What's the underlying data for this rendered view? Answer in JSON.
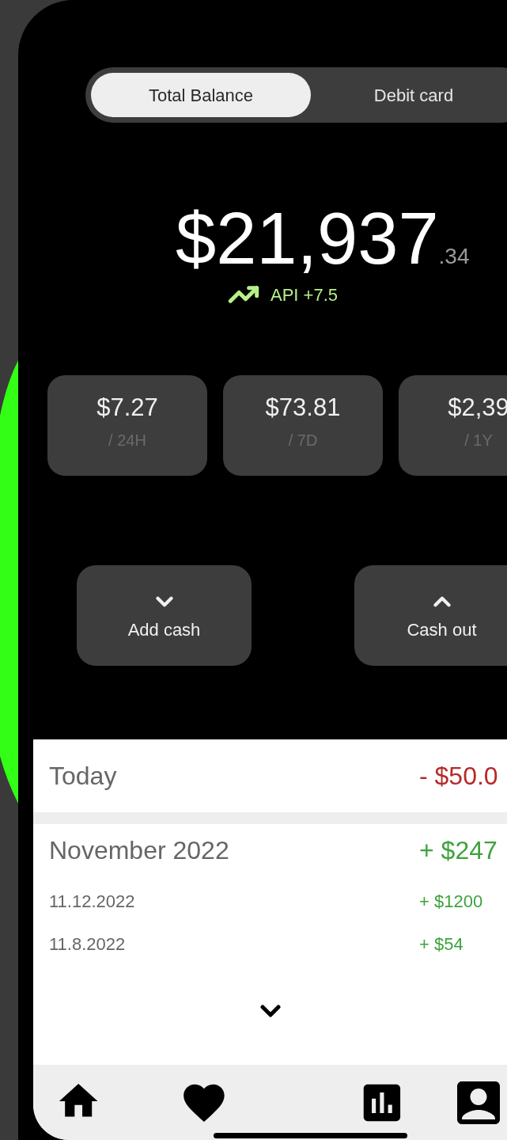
{
  "tabs": [
    {
      "label": "Total Balance",
      "selected": true
    },
    {
      "label": "Debit card",
      "selected": false
    }
  ],
  "balance": {
    "whole": "$21,937",
    "cents": ".34"
  },
  "trend": {
    "label": "API +7.5"
  },
  "stats": [
    {
      "value": "$7.27",
      "period": "/ 24H"
    },
    {
      "value": "$73.81",
      "period": "/ 7D"
    },
    {
      "value": "$2,39",
      "period": "/ 1Y"
    }
  ],
  "actions": [
    {
      "label": "Add cash",
      "kind": "add"
    },
    {
      "label": "Cash out",
      "kind": "withdraw"
    }
  ],
  "transactions": [
    {
      "title": "Today",
      "amount": "- $50.0",
      "kind": "debit"
    },
    {
      "title": "November 2022",
      "amount": "+ $247",
      "kind": "credit",
      "entries": [
        {
          "date": "11.12.2022",
          "amount": "+ $1200"
        },
        {
          "date": "11.8.2022",
          "amount": "+ $54"
        }
      ]
    }
  ]
}
